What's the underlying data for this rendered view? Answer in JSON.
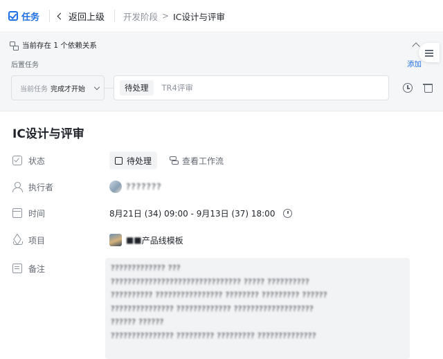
{
  "topbar": {
    "tag_label": "任务",
    "back_label": "返回上级",
    "breadcrumb_parent": "开发阶段",
    "breadcrumb_separator": ">",
    "breadcrumb_current": "IC设计与评审"
  },
  "dependency": {
    "header": "当前存在 1 个依赖关系",
    "after_label": "后置任务",
    "add_label": "添加",
    "condition_label": "当前任务",
    "condition_value": "完成才开始",
    "target_status": "待处理",
    "target_name": "TR4评审"
  },
  "task": {
    "title": "IC设计与评审",
    "fields": {
      "status_label": "状态",
      "status_value": "待处理",
      "workflow_label": "查看工作流",
      "assignee_label": "执行者",
      "assignee_name": "???????",
      "time_label": "时间",
      "time_value": "8月21日 (34) 09:00 - 9月13日 (37) 18:00",
      "project_label": "项目",
      "project_prefix": "■■",
      "project_name": "产品线模板",
      "notes_label": "备注"
    },
    "notes_lines": [
      "????????????? ???",
      "??????????????????????????????? ????? ??????????",
      "?????????? ???????????????? ???????? ????????? ??????",
      "??????????????? ????????????? ???????????????????",
      "?????? ??????",
      "??????????????? ????????? ????????? ??????????????"
    ]
  },
  "colors": {
    "accent": "#1f6fe5",
    "panel_bg": "#f5f6f7",
    "chip_bg": "#f2f3f5",
    "text_primary": "#1f2329",
    "text_secondary": "#646a73",
    "text_muted": "#8f959e"
  },
  "icons": {
    "tag": "checkbox-icon",
    "back": "chevron-left-icon",
    "dependency": "dependency-icon",
    "collapse": "chevron-up-icon",
    "side_panel": "list-icon",
    "clock": "clock-icon",
    "trash": "trash-icon",
    "status": "check-square-icon",
    "assignee": "user-icon",
    "time": "calendar-icon",
    "project": "layers-icon",
    "notes": "note-icon",
    "workflow": "workflow-icon",
    "alarm": "alarm-icon"
  }
}
